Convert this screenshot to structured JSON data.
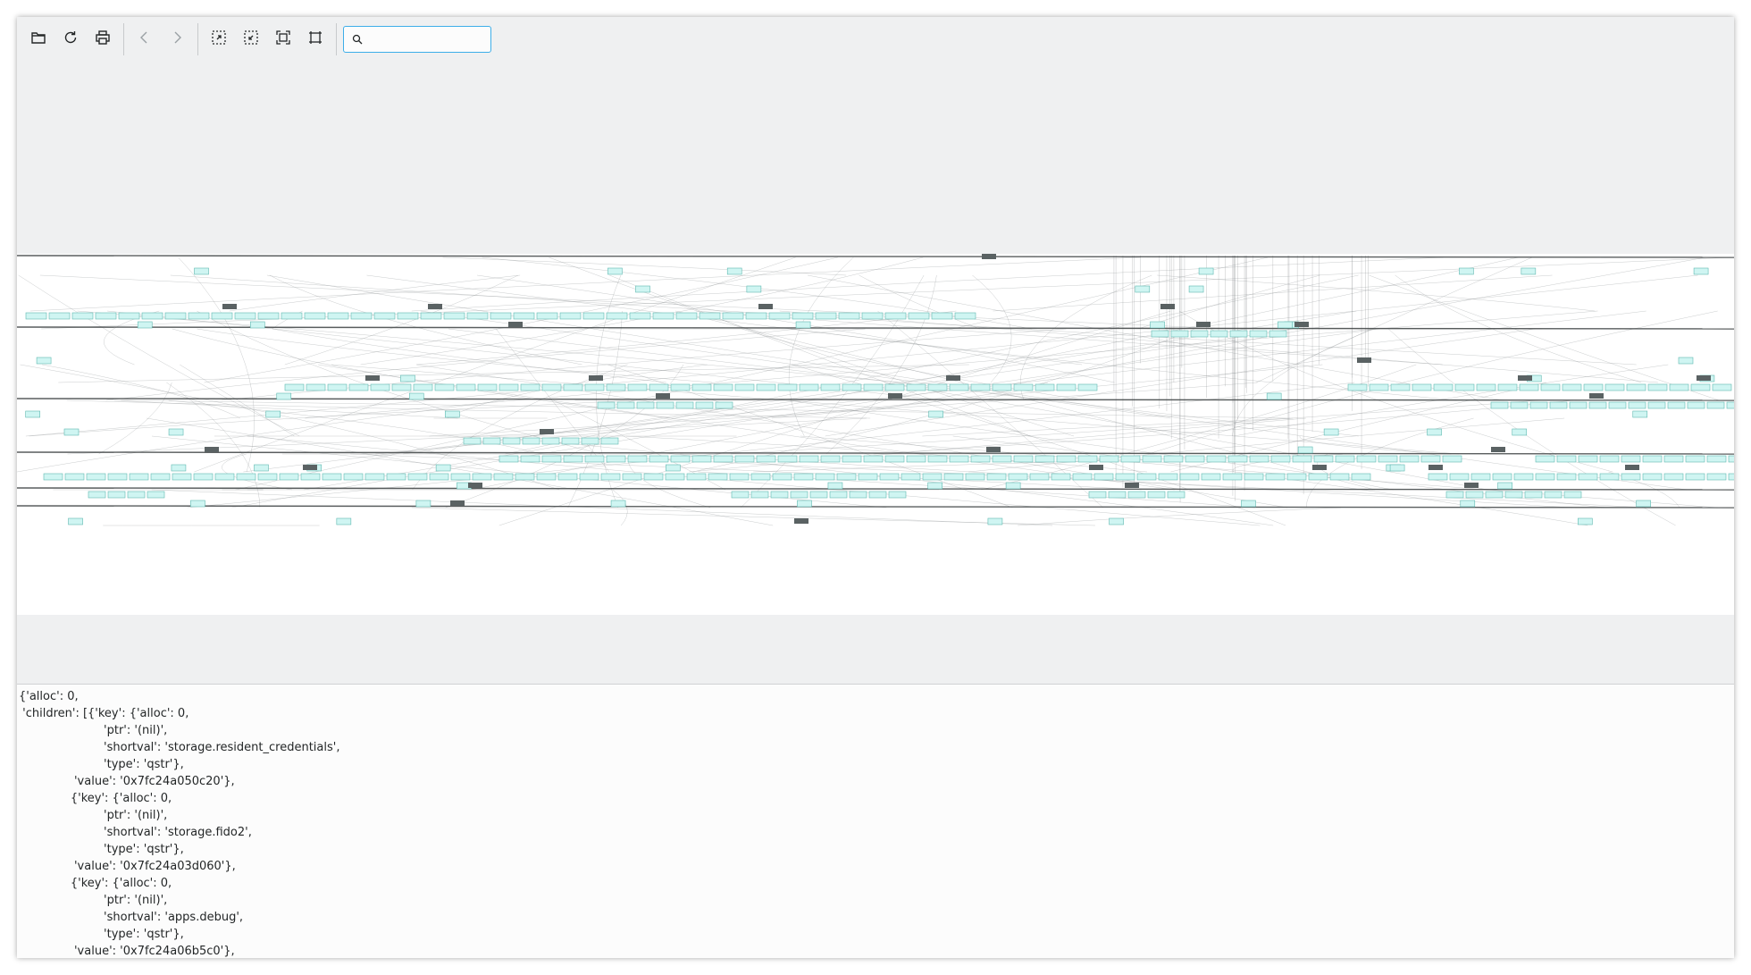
{
  "toolbar": {
    "buttons": [
      {
        "name": "open-icon",
        "label": "Open"
      },
      {
        "name": "reload-icon",
        "label": "Reload"
      },
      {
        "name": "print-icon",
        "label": "Print"
      },
      {
        "name": "back-icon",
        "label": "Back"
      },
      {
        "name": "forward-icon",
        "label": "Forward"
      },
      {
        "name": "zoom-in-icon",
        "label": "Zoom In"
      },
      {
        "name": "zoom-out-icon",
        "label": "Zoom Out"
      },
      {
        "name": "zoom-fit-icon",
        "label": "Zoom to Fit"
      },
      {
        "name": "zoom-original-icon",
        "label": "Original Size"
      }
    ],
    "search": {
      "value": "",
      "placeholder": ""
    }
  },
  "details": {
    "lines": [
      "{'alloc': 0,",
      " 'children': [{'key': {'alloc': 0,",
      "                       'ptr': '(nil)',",
      "                       'shortval': 'storage.resident_credentials',",
      "                       'type': 'qstr'},",
      "               'value': '0x7fc24a050c20'},",
      "              {'key': {'alloc': 0,",
      "                       'ptr': '(nil)',",
      "                       'shortval': 'storage.fido2',",
      "                       'type': 'qstr'},",
      "               'value': '0x7fc24a03d060'},",
      "              {'key': {'alloc': 0,",
      "                       'ptr': '(nil)',",
      "                       'shortval': 'apps.debug',",
      "                       'type': 'qstr'},",
      "               'value': '0x7fc24a06b5c0'},"
    ]
  },
  "colors": {
    "node_fill": "#cff5f2",
    "node_stroke": "#5fb8b0",
    "hub_fill": "#5a6263",
    "edge": "#8a8e90",
    "accent": "#3daee9"
  }
}
